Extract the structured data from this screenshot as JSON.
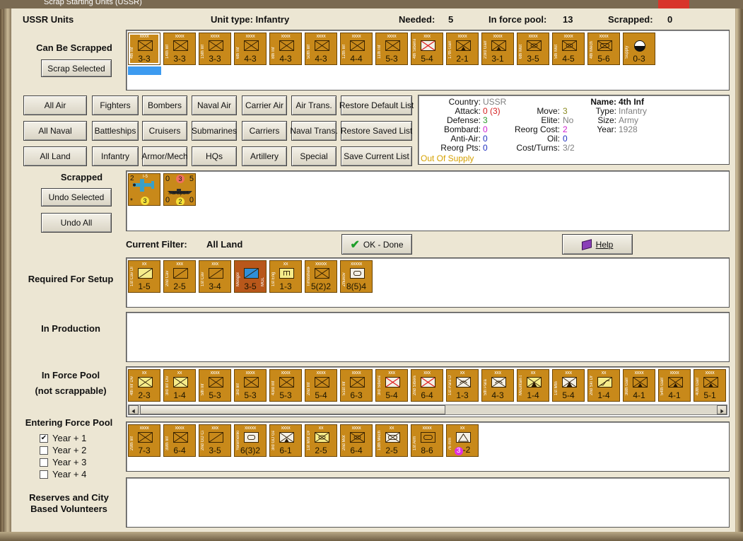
{
  "window_title": "Scrap Starting Units (USSR)",
  "header": {
    "title": "USSR Units",
    "unit_type": "Unit type: Infantry",
    "needed_label": "Needed:",
    "needed": "5",
    "pool_label": "In force pool:",
    "pool": "13",
    "scrapped_label": "Scrapped:",
    "scrapped": "0"
  },
  "sections": {
    "can_be_scrapped": "Can Be Scrapped",
    "scrapped": "Scrapped",
    "current_filter_label": "Current Filter:",
    "current_filter_value": "All Land",
    "required": "Required For Setup",
    "in_production": "In Production",
    "force_pool_1": "In Force Pool",
    "force_pool_2": "(not scrappable)",
    "entering": "Entering Force Pool",
    "reserves_1": "Reserves and City",
    "reserves_2": "Based Volunteers"
  },
  "buttons": {
    "scrap_selected": "Scrap Selected",
    "undo_selected": "Undo Selected",
    "undo_all": "Undo All",
    "ok_done": "OK - Done",
    "help": "Help",
    "filters": [
      [
        "All Air",
        "Fighters",
        "Bombers",
        "Naval Air",
        "Carrier Air",
        "Air Trans.",
        "Restore Default List"
      ],
      [
        "All Naval",
        "Battleships",
        "Cruisers",
        "Submarines",
        "Carriers",
        "Naval Trans.",
        "Restore Saved List"
      ],
      [
        "All Land",
        "Infantry",
        "Armor/Mech",
        "HQs",
        "Artillery",
        "Special",
        "Save Current List"
      ]
    ]
  },
  "info": {
    "country_k": "Country:",
    "country_v": "USSR",
    "attack_k": "Attack:",
    "attack_v": "0 (3)",
    "defense_k": "Defense:",
    "defense_v": "3",
    "bombard_k": "Bombard:",
    "bombard_v": "0",
    "antiair_k": "Anti-Air:",
    "antiair_v": "0",
    "reorgpts_k": "Reorg Pts:",
    "reorgpts_v": "0",
    "supply": "Out Of Supply",
    "move_k": "Move:",
    "move_v": "3",
    "elite_k": "Elite:",
    "elite_v": "No",
    "reorgcost_k": "Reorg Cost:",
    "reorgcost_v": "2",
    "oil_k": "Oil:",
    "oil_v": "0",
    "costturns_k": "Cost/Turns:",
    "costturns_v": "3/2",
    "name_k": "Name:",
    "name_v": "4th Inf",
    "type_k": "Type:",
    "type_v": "Infantry",
    "size_k": "Size:",
    "size_v": "Army",
    "year_k": "Year:",
    "year_v": "1928"
  },
  "entering_years": [
    {
      "label": "Year + 1",
      "checked": true
    },
    {
      "label": "Year + 2",
      "checked": false
    },
    {
      "label": "Year + 3",
      "checked": false
    },
    {
      "label": "Year + 4",
      "checked": false
    }
  ],
  "scrappable_units": [
    {
      "size": "xxxx",
      "name": "4th Inf",
      "str": "3-3",
      "sym": "inf",
      "selected": true
    },
    {
      "size": "xxxx",
      "name": "14th Inf",
      "str": "3-3",
      "sym": "inf"
    },
    {
      "size": "xxxx",
      "name": "15th Inf",
      "str": "3-3",
      "sym": "inf"
    },
    {
      "size": "xxxx",
      "name": "6th Inf",
      "str": "4-3",
      "sym": "inf"
    },
    {
      "size": "xxxx",
      "name": "8th Inf",
      "str": "4-3",
      "sym": "inf"
    },
    {
      "size": "xxxx",
      "name": "50th Inf",
      "str": "4-3",
      "sym": "inf"
    },
    {
      "size": "xxxx",
      "name": "12th Inf",
      "str": "4-4",
      "sym": "inf"
    },
    {
      "size": "xxxx",
      "name": "11th Inf",
      "str": "5-3",
      "sym": "inf"
    },
    {
      "size": "xxx",
      "name": "4th Siberian",
      "str": "5-4",
      "sym": "inf-red"
    },
    {
      "size": "xxxx",
      "name": "17th Garr",
      "str": "2-1",
      "sym": "garr"
    },
    {
      "size": "xxxx",
      "name": "23rd Garr",
      "str": "3-1",
      "sym": "garr"
    },
    {
      "size": "xxxx",
      "name": "6th Mot",
      "str": "3-5",
      "sym": "mot"
    },
    {
      "size": "xxxx",
      "name": "5th Mot",
      "str": "4-5",
      "sym": "mot"
    },
    {
      "size": "xxxx",
      "name": "4th Mech",
      "str": "5-6",
      "sym": "mech"
    },
    {
      "size": "",
      "name": "Supply",
      "str": "0-3",
      "sym": "supply"
    }
  ],
  "scrapped_units": [
    {
      "kind": "air",
      "tl": "2",
      "tr": "",
      "bl": "*",
      "dot": "3",
      "name": "I-5",
      "str": ""
    },
    {
      "kind": "naval",
      "tl": "0",
      "tr": "5",
      "bl": "0",
      "br": "0",
      "dotTop": "3",
      "dot": "2",
      "name": "Transport"
    }
  ],
  "required_units": [
    {
      "size": "xx",
      "name": "1st Cav Div",
      "str": "1-5",
      "sym": "cav-y"
    },
    {
      "size": "xxx",
      "name": "2nd Cav",
      "str": "2-5",
      "sym": "cav"
    },
    {
      "size": "xxx",
      "name": "1st Cav",
      "str": "3-4",
      "sym": "cav"
    },
    {
      "size": "",
      "name": "Mongol",
      "str": "3-5",
      "sym": "cav-blue",
      "orange": true,
      "right": "MGL"
    },
    {
      "size": "xx",
      "name": "1st Eng",
      "str": "1-3",
      "sym": "eng-y"
    },
    {
      "size": "xxxxx",
      "name": "Timoshenko",
      "str": "5(2)2",
      "sym": "hq"
    },
    {
      "size": "xxxxx",
      "name": "Zhukov",
      "str": "8(5)4",
      "sym": "hq-w"
    }
  ],
  "force_pool_units": [
    {
      "size": "xx",
      "name": "4th Inf Div",
      "str": "2-3",
      "sym": "inf-y"
    },
    {
      "size": "xx",
      "name": "3rd Inf Div",
      "str": "1-4",
      "sym": "inf-y"
    },
    {
      "size": "xxxx",
      "name": "5th Inf",
      "str": "5-3",
      "sym": "inf"
    },
    {
      "size": "xxxx",
      "name": "3rd Inf",
      "str": "5-3",
      "sym": "inf"
    },
    {
      "size": "xxxx",
      "name": "43rd Inf",
      "str": "5-3",
      "sym": "inf"
    },
    {
      "size": "xxxx",
      "name": "2nd Inf",
      "str": "5-4",
      "sym": "inf"
    },
    {
      "size": "xxxx",
      "name": "51st Inf",
      "str": "6-3",
      "sym": "inf"
    },
    {
      "size": "xxx",
      "name": "3rd Siberian",
      "str": "5-4",
      "sym": "inf-red"
    },
    {
      "size": "xxx",
      "name": "2nd Siberian",
      "str": "6-4",
      "sym": "inf-red"
    },
    {
      "size": "xx",
      "name": "1st Para Div",
      "str": "1-3",
      "sym": "para"
    },
    {
      "size": "xxx",
      "name": "5th Para",
      "str": "4-3",
      "sym": "para"
    },
    {
      "size": "xx",
      "name": "Mountain D.",
      "str": "1-4",
      "sym": "mtn-y"
    },
    {
      "size": "xxx",
      "name": "1st Mtn",
      "str": "5-4",
      "sym": "mtn"
    },
    {
      "size": "xx",
      "name": "2nd Ski Div",
      "str": "1-4",
      "sym": "ski-y"
    },
    {
      "size": "xxxx",
      "name": "36th Garr",
      "str": "4-1",
      "sym": "garr"
    },
    {
      "size": "xxxx",
      "name": "54th Garr",
      "str": "4-1",
      "sym": "garr"
    },
    {
      "size": "xxxx",
      "name": "40th Garr",
      "str": "5-1",
      "sym": "garr"
    }
  ],
  "entering_units": [
    {
      "size": "xxxx",
      "name": "29th Inf",
      "str": "7-3",
      "sym": "inf"
    },
    {
      "size": "xxxx",
      "name": "39th Inf",
      "str": "6-4",
      "sym": "inf"
    },
    {
      "size": "xxx",
      "name": "2nd GD Cav",
      "str": "3-5",
      "sym": "cav"
    },
    {
      "size": "xxxxx",
      "name": "Yeremenko",
      "str": "6(3)2",
      "sym": "hq-w"
    },
    {
      "size": "xxxx",
      "name": "3rd GD Garr",
      "str": "6-1",
      "sym": "garr-w"
    },
    {
      "size": "xx",
      "name": "1st Mot Div",
      "str": "2-5",
      "sym": "mot-y"
    },
    {
      "size": "xxxx",
      "name": "2nd Mot",
      "str": "6-4",
      "sym": "mot"
    },
    {
      "size": "xx",
      "name": "13th Mech",
      "str": "2-5",
      "sym": "mech-w"
    },
    {
      "size": "xxxx",
      "name": "1st Arm",
      "str": "8-6",
      "sym": "arm"
    },
    {
      "size": "xx",
      "name": "76 mm",
      "str": "3-2",
      "sym": "art-w",
      "dot": "3"
    }
  ],
  "colors": {
    "counter": "#c8891a",
    "panel_bg": "#ece6d3",
    "attack": "#d42020",
    "defense": "#2a9a2a",
    "bombard": "#d020d0",
    "supply": "#d6a100",
    "grey_val": "#808080"
  }
}
